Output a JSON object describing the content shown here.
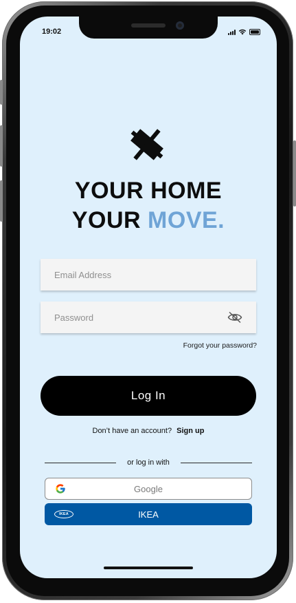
{
  "status_bar": {
    "time": "19:02"
  },
  "brand": {
    "headline_line1": "YOUR HOME",
    "headline_line2_prefix": "YOUR",
    "headline_line2_accent": "MOVE.",
    "accent_color": "#6fa4d6"
  },
  "login_form": {
    "email_placeholder": "Email Address",
    "email_value": "",
    "password_placeholder": "Password",
    "password_value": "",
    "password_toggle_icon": "eye-slash-icon",
    "forgot_password": "Forgot your password?",
    "login_button": "Log In"
  },
  "signup": {
    "prompt": "Don’t have an account?",
    "link": "Sign up"
  },
  "social_login": {
    "divider_text": "or log in with",
    "google_label": "Google",
    "ikea_label": "IKEA",
    "ikea_logo_text": "IKEA",
    "ikea_color": "#0058a3"
  }
}
